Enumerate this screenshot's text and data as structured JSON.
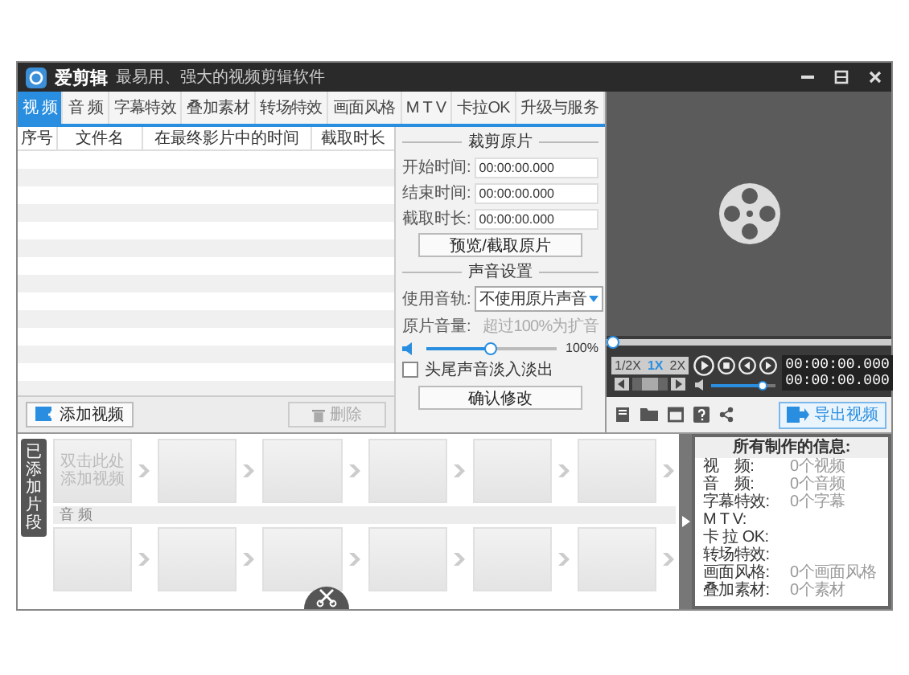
{
  "window": {
    "app_name": "爱剪辑",
    "slogan": "最易用、强大的视频剪辑软件"
  },
  "tabs": [
    {
      "label": "视 频",
      "selected": true
    },
    {
      "label": "音 频",
      "selected": false
    },
    {
      "label": "字幕特效",
      "selected": false
    },
    {
      "label": "叠加素材",
      "selected": false
    },
    {
      "label": "转场特效",
      "selected": false
    },
    {
      "label": "画面风格",
      "selected": false
    },
    {
      "label": "M T V",
      "selected": false
    },
    {
      "label": "卡拉OK",
      "selected": false
    },
    {
      "label": "升级与服务",
      "selected": false
    }
  ],
  "clip_table": {
    "columns": [
      "序号",
      "文件名",
      "在最终影片中的时间",
      "截取时长"
    ]
  },
  "clip_buttons": [
    {
      "label": "添加视频",
      "disabled": false
    },
    {
      "label": "删除",
      "disabled": true
    }
  ],
  "trim_panel": {
    "title": "裁剪原片",
    "fields": [
      {
        "label": "开始时间:",
        "value": "00:00:00.000"
      },
      {
        "label": "结束时间:",
        "value": "00:00:00.000"
      },
      {
        "label": "截取时长:",
        "value": "00:00:00.000"
      }
    ],
    "preview_button": "预览/截取原片"
  },
  "sound_panel": {
    "title": "声音设置",
    "track_label": "使用音轨:",
    "track_value": "不使用原片声音",
    "volume_label": "原片音量:",
    "volume_hint": "超过100%为扩音",
    "volume": {
      "level": 0.5,
      "reading": "100%"
    },
    "fade": {
      "label": "头尾声音淡入淡出",
      "checked": false
    },
    "confirm_button": "确认修改"
  },
  "player": {
    "progress": {
      "level": 0
    },
    "speeds": [
      {
        "label": "1/2X",
        "selected": false
      },
      {
        "label": "1X",
        "selected": true
      },
      {
        "label": "2X",
        "selected": false
      }
    ],
    "jog": {
      "level": 0.5
    },
    "times": [
      "00:00:00.000",
      "00:00:00.000"
    ],
    "volume": {
      "level": 0.8
    },
    "export_button": "导出视频"
  },
  "timeline": {
    "tab_label": "已添加片段",
    "slot_hint": [
      "双击此处",
      "添加视频"
    ],
    "audio_label": "音 频"
  },
  "info": {
    "title": "所有制作的信息:",
    "rows": [
      {
        "label": "视　频:",
        "value": "0个视频"
      },
      {
        "label": "音　频:",
        "value": "0个音频"
      },
      {
        "label": "字幕特效:",
        "value": "0个字幕"
      },
      {
        "label": "M T V:"
      },
      {
        "label": "卡 拉 OK:"
      },
      {
        "label": "转场特效:"
      },
      {
        "label": "画面风格:",
        "value": "0个画面风格"
      },
      {
        "label": "叠加素材:",
        "value": "0个素材"
      }
    ]
  }
}
